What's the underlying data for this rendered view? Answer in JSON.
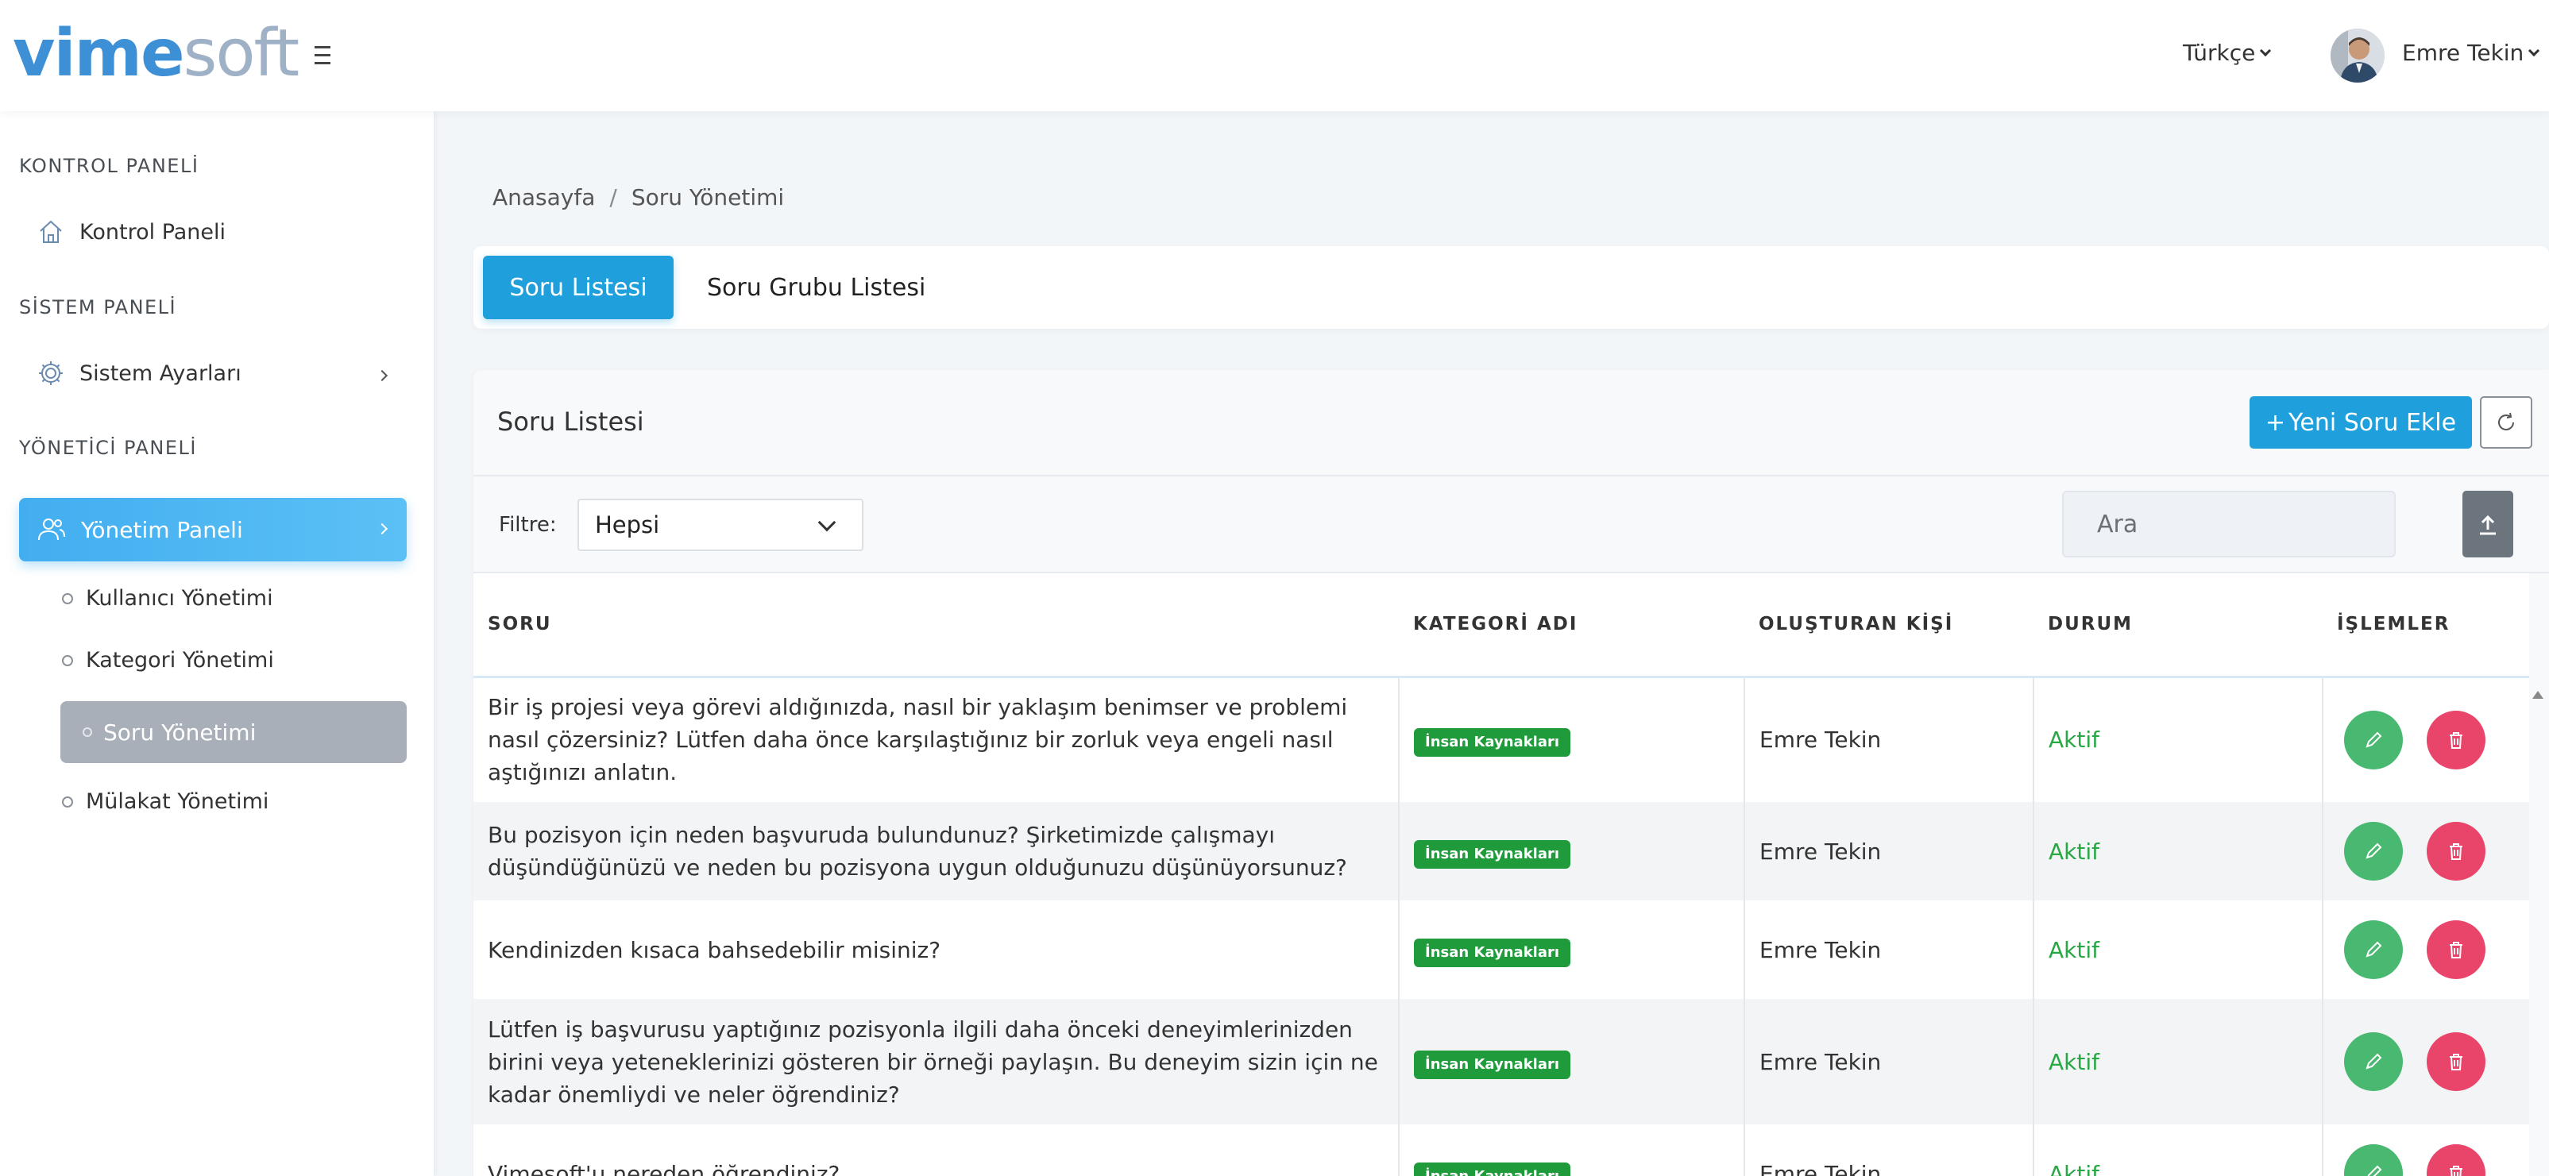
{
  "brand": {
    "part1": "vime",
    "part2": "soft"
  },
  "header": {
    "language": "Türkçe",
    "user_name": "Emre Tekin"
  },
  "sidebar": {
    "sections": [
      {
        "title": "KONTROL PANELİ"
      },
      {
        "title": "SİSTEM PANELİ"
      },
      {
        "title": "YÖNETİCİ PANELİ"
      }
    ],
    "items": {
      "kontrol_paneli": "Kontrol Paneli",
      "sistem_ayarlari": "Sistem Ayarları",
      "yonetim_paneli": "Yönetim Paneli"
    },
    "sub_items": {
      "kullanici": "Kullanıcı Yönetimi",
      "kategori": "Kategori Yönetimi",
      "soru": "Soru Yönetimi",
      "mulakat": "Mülakat Yönetimi"
    }
  },
  "breadcrumb": {
    "home": "Anasayfa",
    "separator": "/",
    "current": "Soru Yönetimi"
  },
  "tabs": {
    "active": "Soru Listesi",
    "other": "Soru Grubu Listesi"
  },
  "card": {
    "title": "Soru Listesi",
    "new_button": "Yeni Soru Ekle",
    "new_button_plus": "+",
    "filter_label": "Filtre:",
    "filter_value": "Hepsi",
    "search_placeholder": "Ara"
  },
  "table": {
    "headers": [
      "SORU",
      "KATEGORİ ADI",
      "OLUŞTURAN KİŞİ",
      "DURUM",
      "İŞLEMLER"
    ],
    "rows": [
      {
        "question": "Bir iş projesi veya görevi aldığınızda, nasıl bir yaklaşım benimser ve problemi nasıl çözersiniz? Lütfen daha önce karşılaştığınız bir zorluk veya engeli nasıl aştığınızı anlatın.",
        "category": "İnsan Kaynakları",
        "creator": "Emre Tekin",
        "status": "Aktif"
      },
      {
        "question": "Bu pozisyon için neden başvuruda bulundunuz? Şirketimizde çalışmayı düşündüğünüzü ve neden bu pozisyona uygun olduğunuzu düşünüyorsunuz?",
        "category": "İnsan Kaynakları",
        "creator": "Emre Tekin",
        "status": "Aktif"
      },
      {
        "question": "Kendinizden kısaca bahsedebilir misiniz?",
        "category": "İnsan Kaynakları",
        "creator": "Emre Tekin",
        "status": "Aktif"
      },
      {
        "question": "Lütfen iş başvurusu yaptığınız pozisyonla ilgili daha önceki deneyimlerinizden birini veya yeteneklerinizi gösteren bir örneği paylaşın. Bu deneyim sizin için ne kadar önemliydi ve neler öğrendiniz?",
        "category": "İnsan Kaynakları",
        "creator": "Emre Tekin",
        "status": "Aktif"
      },
      {
        "question": "Vimesoft'u nereden öğrendiniz?",
        "category": "İnsan Kaynakları",
        "creator": "Emre Tekin",
        "status": "Aktif"
      }
    ]
  },
  "colors": {
    "primary": "#1fa0dc",
    "success": "#28a745",
    "danger": "#e9456a",
    "edit": "#49b871",
    "badge": "#1f9b3c"
  },
  "icons": [
    "hamburger-icon",
    "chevron-down-icon",
    "home-icon",
    "gear-icon",
    "users-icon",
    "chevron-right-icon",
    "refresh-icon",
    "upload-icon",
    "pencil-icon",
    "trash-icon"
  ]
}
